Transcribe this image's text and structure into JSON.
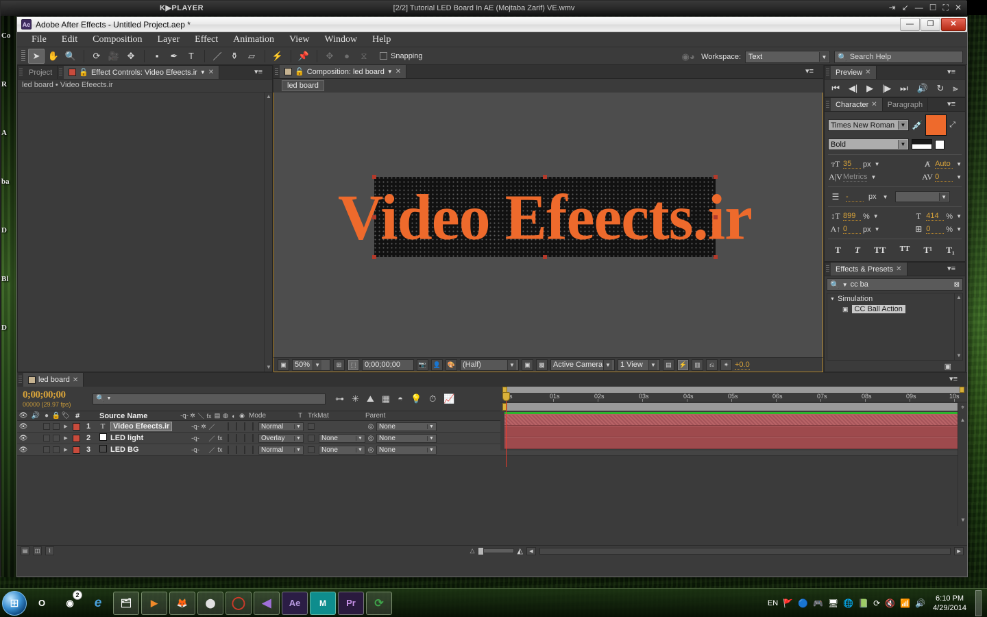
{
  "kmplayer": {
    "logo": "K▶PLAYER",
    "title": "[2/2] Tutorial LED Board In AE (Mojtaba Zarif) VE.wmv",
    "buttons": [
      "⇥",
      "↙",
      "—",
      "☐",
      "⛶",
      "✕"
    ]
  },
  "desktop_icons": [
    "Co",
    "R",
    "A",
    "ba",
    "D",
    "Bl",
    "D"
  ],
  "ae": {
    "title": "Adobe After Effects - Untitled Project.aep *",
    "icon_label": "Ae",
    "window_buttons": {
      "minimize": "—",
      "maximize": "❐",
      "close": "✕"
    },
    "menu": [
      "File",
      "Edit",
      "Composition",
      "Layer",
      "Effect",
      "Animation",
      "View",
      "Window",
      "Help"
    ],
    "toolbar": {
      "tools": [
        {
          "name": "selection-tool",
          "glyph": "➤",
          "active": true
        },
        {
          "name": "hand-tool",
          "glyph": "✋",
          "active": false
        },
        {
          "name": "zoom-tool",
          "glyph": "🔍",
          "active": false
        },
        {
          "name": "rotation-tool",
          "glyph": "⟳",
          "active": false
        },
        {
          "name": "camera-tool",
          "glyph": "🎥",
          "active": false
        },
        {
          "name": "pan-behind-tool",
          "glyph": "✥",
          "active": false
        },
        {
          "name": "shape-tool",
          "glyph": "▪",
          "active": false
        },
        {
          "name": "pen-tool",
          "glyph": "✒",
          "active": false
        },
        {
          "name": "type-tool",
          "glyph": "T",
          "active": false
        },
        {
          "name": "brush-tool",
          "glyph": "／",
          "active": false
        },
        {
          "name": "clone-stamp-tool",
          "glyph": "⚱",
          "active": false
        },
        {
          "name": "eraser-tool",
          "glyph": "▱",
          "active": false
        },
        {
          "name": "roto-brush-tool",
          "glyph": "⚡",
          "active": false
        },
        {
          "name": "puppet-pin-tool",
          "glyph": "📌",
          "active": false
        }
      ],
      "dim_tools": [
        {
          "name": "move-anchor-icon",
          "glyph": "✥"
        },
        {
          "name": "dot-icon",
          "glyph": "●"
        },
        {
          "name": "mask-icon",
          "glyph": "⧖"
        }
      ],
      "snapping_label": "Snapping",
      "workspace_label": "Workspace:",
      "workspace_value": "Text",
      "search_help_placeholder": "Search Help"
    },
    "effect_controls": {
      "tab_project": "Project",
      "tab_title": "Effect Controls: Video Efeects.ir",
      "breadcrumb": "led board • Video Efeects.ir"
    },
    "composition": {
      "tab_title": "Composition: led board",
      "comp_name": "led board",
      "led_text": "Video Efeects.ir",
      "led_text_color": "#ee6a2c",
      "viewer_bar": {
        "magnification": "50%",
        "timecode": "0;00;00;00",
        "resolution": "(Half)",
        "view": "Active Camera",
        "views": "1 View",
        "exposure": "+0.0"
      }
    },
    "preview": {
      "tab_title": "Preview",
      "buttons": [
        "⏮",
        "◀|",
        "▶",
        "|▶",
        "⏭",
        "🔊",
        "↻",
        "⫸"
      ]
    },
    "character": {
      "tab_title": "Character",
      "tab_paragraph": "Paragraph",
      "font_family": "Times New Roman",
      "font_style": "Bold",
      "font_size": "35",
      "font_size_unit": "px",
      "leading": "Auto",
      "kerning": "Metrics",
      "tracking": "0",
      "stroke_width": "-",
      "stroke_width_unit": "px",
      "vertical_scale": "899",
      "vertical_scale_unit": "%",
      "horizontal_scale": "414",
      "horizontal_scale_unit": "%",
      "baseline_shift": "0",
      "baseline_shift_unit": "px",
      "tsume": "0",
      "tsume_unit": "%",
      "fill_color": "#ee6a2c",
      "style_buttons": [
        "T",
        "T",
        "TT",
        "TT",
        "T¹",
        "T₁"
      ]
    },
    "effects_presets": {
      "tab_title": "Effects & Presets",
      "search_value": "cc ba",
      "category": "Simulation",
      "items": [
        "CC Ball Action"
      ]
    },
    "timeline": {
      "tab_title": "led board",
      "timecode": "0;00;00;00",
      "frame_info": "00000 (29.97 fps)",
      "columns": {
        "source_name": "Source Name",
        "hash": "#",
        "mode": "Mode",
        "t": "T",
        "trkmat": "TrkMat",
        "parent": "Parent"
      },
      "switch_icons": [
        "-ꝗ-",
        "✲",
        "＼",
        "fx",
        "▤",
        "◍",
        "◐",
        "◉"
      ],
      "layers": [
        {
          "index": "1",
          "type_icon": "T",
          "name": "Video Efeects.ir",
          "name_selected": true,
          "color": "#c0392b",
          "source_swatch": null,
          "mode": "Normal",
          "trkmat": null,
          "parent": "None",
          "switches": [
            "-ꝗ-",
            "✲",
            "／",
            ""
          ]
        },
        {
          "index": "2",
          "type_icon": "",
          "name": "LED light",
          "name_selected": false,
          "color": "#c0392b",
          "source_swatch": "#ffffff",
          "mode": "Overlay",
          "trkmat": "None",
          "parent": "None",
          "switches": [
            "-ꝗ-",
            "",
            "／",
            "fx"
          ]
        },
        {
          "index": "3",
          "type_icon": "",
          "name": "LED BG",
          "name_selected": false,
          "color": "#c0392b",
          "source_swatch": "#4a4a4a",
          "mode": "Normal",
          "trkmat": "None",
          "parent": "None",
          "switches": [
            "-ꝗ-",
            "",
            "／",
            "fx"
          ]
        }
      ],
      "ruler_ticks": [
        "0s",
        "01s",
        "02s",
        "03s",
        "04s",
        "05s",
        "06s",
        "07s",
        "08s",
        "09s",
        "10s"
      ]
    }
  },
  "taskbar": {
    "start_glyph": "⊞",
    "items": [
      {
        "name": "opera-icon",
        "glyph": "O",
        "framed": false,
        "badge": null
      },
      {
        "name": "camera-app-icon",
        "glyph": "◉",
        "framed": false,
        "badge": "2"
      },
      {
        "name": "internet-explorer-icon",
        "glyph": "e",
        "framed": false,
        "badge": null
      },
      {
        "name": "windows-explorer-icon",
        "glyph": "🗂",
        "framed": true,
        "badge": null
      },
      {
        "name": "media-player-icon",
        "glyph": "▶",
        "framed": true,
        "badge": null
      },
      {
        "name": "firefox-icon",
        "glyph": "🦊",
        "framed": true,
        "badge": null
      },
      {
        "name": "nero-icon",
        "glyph": "⬤",
        "framed": true,
        "badge": null
      },
      {
        "name": "opera-red-icon",
        "glyph": "◯",
        "framed": true,
        "badge": null
      },
      {
        "name": "kmplayer-icon",
        "glyph": "◀",
        "framed": true,
        "badge": null
      },
      {
        "name": "after-effects-icon",
        "glyph": "Ae",
        "framed": true,
        "badge": null
      },
      {
        "name": "maya-icon",
        "glyph": "M",
        "framed": true,
        "badge": null
      },
      {
        "name": "premiere-pro-icon",
        "glyph": "Pr",
        "framed": true,
        "badge": null
      },
      {
        "name": "idm-icon",
        "glyph": "⟳",
        "framed": true,
        "badge": null
      }
    ],
    "language": "EN",
    "tray_icons": [
      "🚩",
      "🔵",
      "🎮",
      "🖥",
      "🌐",
      "📗",
      "⟳",
      "🔇",
      "📶",
      "🔊"
    ],
    "time": "6:10 PM",
    "date": "4/29/2014"
  }
}
